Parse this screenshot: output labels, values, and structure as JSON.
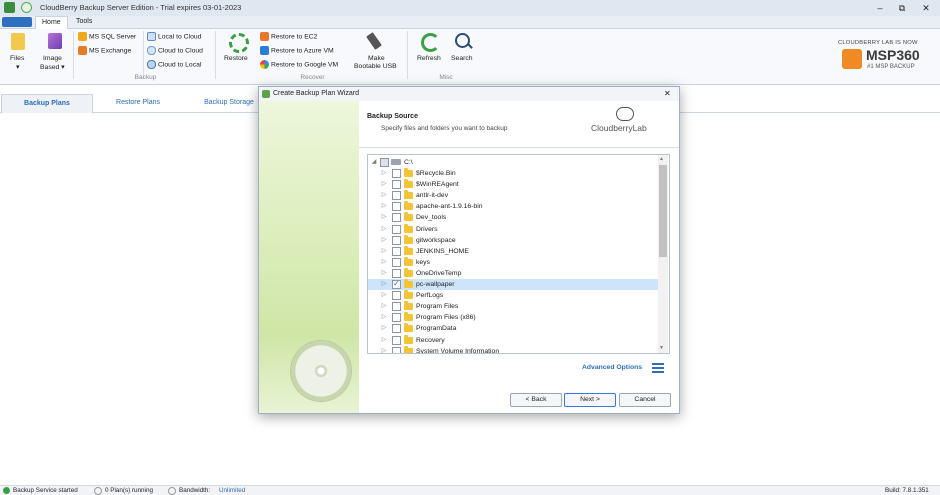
{
  "window": {
    "title": "CloudBerry Backup Server Edition - Trial expires 03-01-2023",
    "minimize": "–",
    "maximize": "⧉",
    "close": "✕"
  },
  "ribbon_tabs": [
    "Home",
    "Tools"
  ],
  "ribbon": {
    "files": {
      "label": "Files",
      "sub": "▾"
    },
    "image": {
      "label": "Image",
      "sub": "Based ▾"
    },
    "ms_sql": "MS SQL Server",
    "ms_exchange": "MS Exchange",
    "local_to_cloud": "Local to Cloud",
    "cloud_to_cloud": "Cloud to Cloud",
    "cloud_to_local": "Cloud to Local",
    "backup_group": "Backup",
    "restore": "Restore",
    "restore_ec2": "Restore to EC2",
    "restore_azure": "Restore to Azure VM",
    "restore_google": "Restore to Google VM",
    "bootable": {
      "line1": "Make",
      "line2": "Bootable USB"
    },
    "recover_group": "Recover",
    "refresh": "Refresh",
    "search": "Search",
    "misc_group": "Misc",
    "brand_small": "CLOUDBERRY LAB IS NOW",
    "brand_big": "MSP360",
    "brand_tag": "#1 MSP BACKUP"
  },
  "nav_tabs": [
    "Backup Plans",
    "Restore Plans",
    "Backup Storage"
  ],
  "dialog": {
    "title": "Create Backup Plan Wizard",
    "close": "✕",
    "heading": "Backup Source",
    "subheading": "Specify files and folders you want to backup",
    "logo_text": "CloudberryLab",
    "root": "C:\\",
    "folders": [
      {
        "name": "$Recycle.Bin",
        "checked": false
      },
      {
        "name": "$WinREAgent",
        "checked": false
      },
      {
        "name": "antlr-it-dev",
        "checked": false
      },
      {
        "name": "apache-ant-1.9.16-bin",
        "checked": false
      },
      {
        "name": "Dev_tools",
        "checked": false
      },
      {
        "name": "Drivers",
        "checked": false
      },
      {
        "name": "gitworkspace",
        "checked": false
      },
      {
        "name": "JENKINS_HOME",
        "checked": false
      },
      {
        "name": "keys",
        "checked": false
      },
      {
        "name": "OneDriveTemp",
        "checked": false
      },
      {
        "name": "pc-wallpaper",
        "checked": true
      },
      {
        "name": "PerfLogs",
        "checked": false
      },
      {
        "name": "Program Files",
        "checked": false
      },
      {
        "name": "Program Files (x86)",
        "checked": false
      },
      {
        "name": "ProgramData",
        "checked": false
      },
      {
        "name": "Recovery",
        "checked": false
      },
      {
        "name": "System Volume Information",
        "checked": false
      }
    ],
    "advanced": "Advanced Options",
    "back": "< Back",
    "next": "Next >",
    "cancel": "Cancel"
  },
  "status": {
    "service": "Backup Service started",
    "plans": "0 Plan(s) running",
    "bandwidth_label": "Bandwidth:",
    "bandwidth_value": "Unlimited",
    "build": "Build: 7.8.1.351"
  },
  "colors": {
    "accent": "#2d6db5",
    "brand_orange": "#f08a24",
    "folder": "#f3c437",
    "selection": "#cde4fb"
  }
}
